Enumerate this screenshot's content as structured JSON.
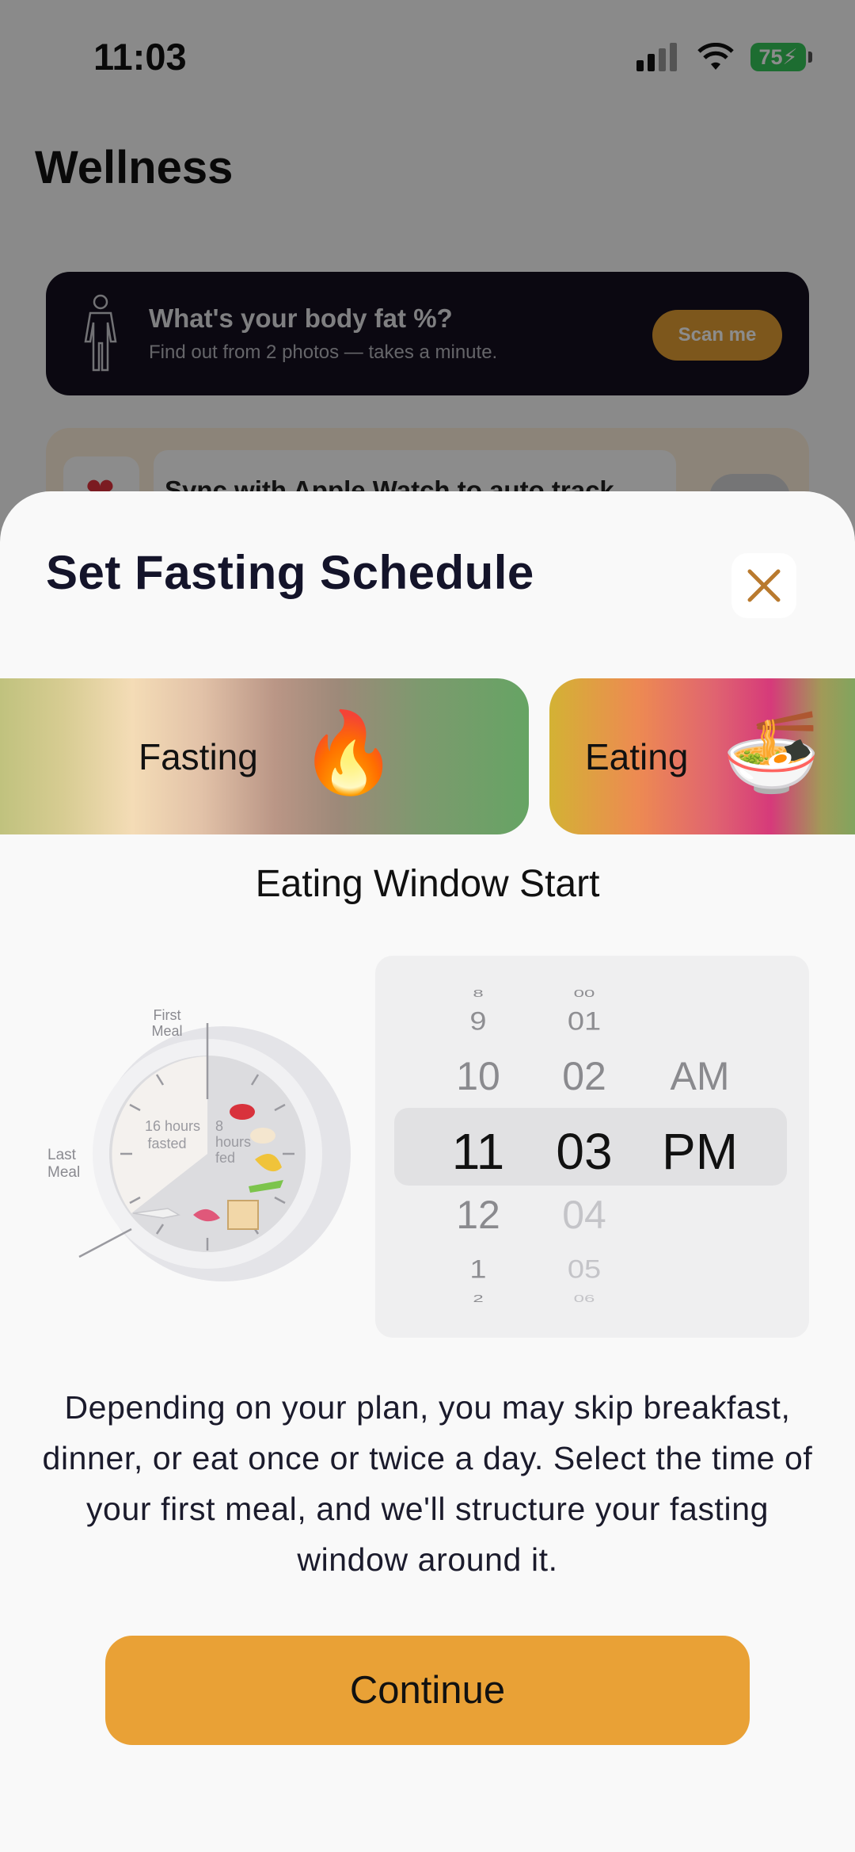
{
  "status_bar": {
    "time": "11:03",
    "battery": "75"
  },
  "background": {
    "title": "Wellness",
    "promo": {
      "title": "What's your body fat %?",
      "subtitle": "Find out from 2 photos — takes a minute.",
      "button": "Scan me"
    },
    "sync": {
      "label": "Sync with Apple Watch to auto track"
    }
  },
  "sheet": {
    "title": "Set Fasting Schedule",
    "cards": {
      "fasting_label": "Fasting",
      "fasting_emoji": "🔥",
      "eating_label": "Eating",
      "eating_emoji": "🍜"
    },
    "window_label": "Eating Window Start",
    "clock": {
      "first_meal_line1": "First",
      "first_meal_line2": "Meal",
      "last_meal_line1": "Last",
      "last_meal_line2": "Meal",
      "fasted_line1": "16 hours",
      "fasted_line2": "fasted",
      "fed_line1": "8",
      "fed_line2": "hours",
      "fed_line3": "fed"
    },
    "picker": {
      "hours": [
        "8",
        "9",
        "10",
        "11",
        "12",
        "1",
        "2"
      ],
      "minutes": [
        "00",
        "01",
        "02",
        "03",
        "04",
        "05",
        "06"
      ],
      "periods": [
        "AM",
        "PM"
      ],
      "selected": {
        "hour": "11",
        "minute": "03",
        "period": "PM"
      }
    },
    "description": "Depending on your plan, you may skip breakfast, dinner, or eat once or twice a day. Select the time of your first meal, and we'll structure your fasting window around it.",
    "continue_button": "Continue"
  }
}
